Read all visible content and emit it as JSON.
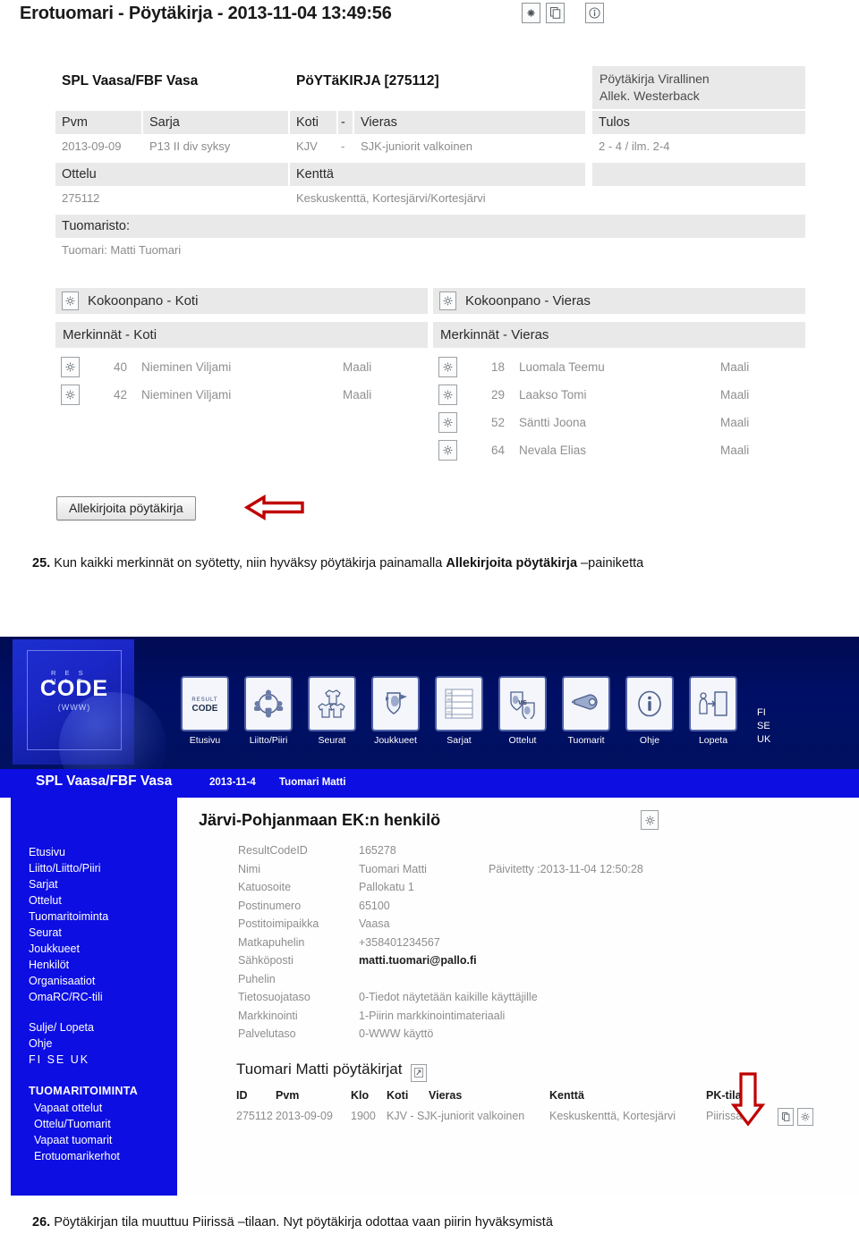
{
  "shot1": {
    "title": "Erotuomari - Pöytäkirja - 2013-11-04 13:49:56",
    "title_icons": [
      "asterisk-icon",
      "copy-icon",
      "info-icon"
    ],
    "org": "SPL Vaasa/FBF Vasa",
    "protocol_heading": "PöYTäKIRJA [275112]",
    "status_block": "Pöytäkirja Virallinen\nAllek. Westerback",
    "match_headers": {
      "pvm": "Pvm",
      "sarja": "Sarja",
      "koti": "Koti",
      "dash": "-",
      "vieras": "Vieras",
      "tulos": "Tulos"
    },
    "match_values": {
      "pvm": "2013-09-09",
      "sarja": "P13 II div syksy",
      "koti": "KJV",
      "dash": "-",
      "vieras": "SJK-juniorit valkoinen",
      "tulos": "2 - 4 / ilm. 2-4"
    },
    "game_headers": {
      "ottelu": "Ottelu",
      "kentta": "Kenttä"
    },
    "game_values": {
      "ottelu": "275112",
      "kentta": "Keskuskenttä, Kortesjärvi/Kortesjärvi"
    },
    "referees_header": "Tuomaristo:",
    "referees_value": "Tuomari: Matti Tuomari",
    "lineup_home": "Kokoonpano - Koti",
    "lineup_away": "Kokoonpano - Vieras",
    "marks_home_header": "Merkinnät - Koti",
    "marks_away_header": "Merkinnät - Vieras",
    "marks_home": [
      {
        "number": "40",
        "player": "Nieminen Viljami",
        "type": "Maali"
      },
      {
        "number": "42",
        "player": "Nieminen Viljami",
        "type": "Maali"
      }
    ],
    "marks_away": [
      {
        "number": "18",
        "player": "Luomala Teemu",
        "type": "Maali"
      },
      {
        "number": "29",
        "player": "Laakso Tomi",
        "type": "Maali"
      },
      {
        "number": "52",
        "player": "Säntti Joona",
        "type": "Maali"
      },
      {
        "number": "64",
        "player": "Nevala Elias",
        "type": "Maali"
      }
    ],
    "sign_button": "Allekirjoita pöytäkirja",
    "arrow_color": "#c00000"
  },
  "caption25": {
    "number": "25.",
    "text_before": " Kun kaikki merkinnät on syötetty, niin hyväksy pöytäkirja painamalla ",
    "bold": "Allekirjoita pöytäkirja",
    "text_after": " –painiketta"
  },
  "caption26": {
    "number": "26.",
    "text": " Pöytäkirjan tila muuttuu Piirissä –tilaan. Nyt pöytäkirja odottaa vaan piirin hyväksymistä"
  },
  "shot2": {
    "logo": {
      "line1": "R E S U L T",
      "line2": "CODE",
      "line3": "(WWW)"
    },
    "nav": [
      {
        "label": "Etusivu",
        "icon": "resultcode-logo-icon"
      },
      {
        "label": "Liitto/Piiri",
        "icon": "people-circle-icon"
      },
      {
        "label": "Seurat",
        "icon": "club-shirts-icon"
      },
      {
        "label": "Joukkueet",
        "icon": "shield-flag-icon"
      },
      {
        "label": "Sarjat",
        "icon": "standings-table-icon"
      },
      {
        "label": "Ottelut",
        "icon": "two-shields-vs-icon"
      },
      {
        "label": "Tuomarit",
        "icon": "whistle-icon"
      },
      {
        "label": "Ohje",
        "icon": "info-circle-icon"
      },
      {
        "label": "Lopeta",
        "icon": "exit-door-icon"
      }
    ],
    "languages": [
      "FI",
      "SE",
      "UK"
    ],
    "context": {
      "org": "SPL Vaasa/FBF Vasa",
      "date": "2013-11-4",
      "user": "Tuomari Matti"
    },
    "sidebar": {
      "items": [
        "Etusivu",
        "Liitto/Liitto/Piiri",
        "Sarjat",
        "Ottelut",
        "Tuomaritoiminta",
        "Seurat",
        "Joukkueet",
        "Henkilöt",
        "Organisaatiot",
        "OmaRC/RC-tili"
      ],
      "secondary": [
        "Sulje/ Lopeta",
        "Ohje"
      ],
      "languages": "FI  SE  UK",
      "section_title": "TUOMARITOIMINTA",
      "section_items": [
        "Vapaat ottelut",
        "Ottelu/Tuomarit",
        "Vapaat tuomarit",
        "Erotuomarikerhot"
      ]
    },
    "person": {
      "title": "Järvi-Pohjanmaan EK:n henkilö",
      "gear_icon": "gear-icon",
      "rows": [
        {
          "label": "ResultCodeID",
          "value": "165278",
          "extra": ""
        },
        {
          "label": "Nimi",
          "value": "Tuomari Matti",
          "extra": "Päivitetty :2013-11-04 12:50:28"
        },
        {
          "label": "Katuosoite",
          "value": "Pallokatu 1",
          "extra": ""
        },
        {
          "label": "Postinumero",
          "value": "65100",
          "extra": ""
        },
        {
          "label": "Postitoimipaikka",
          "value": "Vaasa",
          "extra": ""
        },
        {
          "label": "Matkapuhelin",
          "value": "+358401234567",
          "extra": ""
        },
        {
          "label": "Sähköposti",
          "value": "matti.tuomari@pallo.fi",
          "extra": "",
          "strong": true
        },
        {
          "label": "Puhelin",
          "value": "",
          "extra": ""
        },
        {
          "label": "Tietosuojataso",
          "value": "0-Tiedot näytetään kaikille käyttäjille",
          "extra": ""
        },
        {
          "label": "Markkinointi",
          "value": "1-Piirin markkinointimateriaali",
          "extra": ""
        },
        {
          "label": "Palvelutaso",
          "value": "0-WWW käyttö",
          "extra": ""
        }
      ]
    },
    "protocols": {
      "heading": "Tuomari Matti pöytäkirjat",
      "heading_icon": "link-icon",
      "columns": [
        "ID",
        "Pvm",
        "Klo",
        "Koti",
        "Vieras",
        "Kenttä",
        "PK-tila"
      ],
      "rows": [
        {
          "id": "275112",
          "pvm": "2013-09-09",
          "klo": "1900",
          "koti": "KJV - SJK-juniorit valkoinen",
          "vieras": "",
          "kentta": "Keskuskenttä, Kortesjärvi",
          "tila": "Piirissä",
          "buttons": [
            "copy-icon",
            "gear-icon"
          ]
        }
      ]
    }
  }
}
